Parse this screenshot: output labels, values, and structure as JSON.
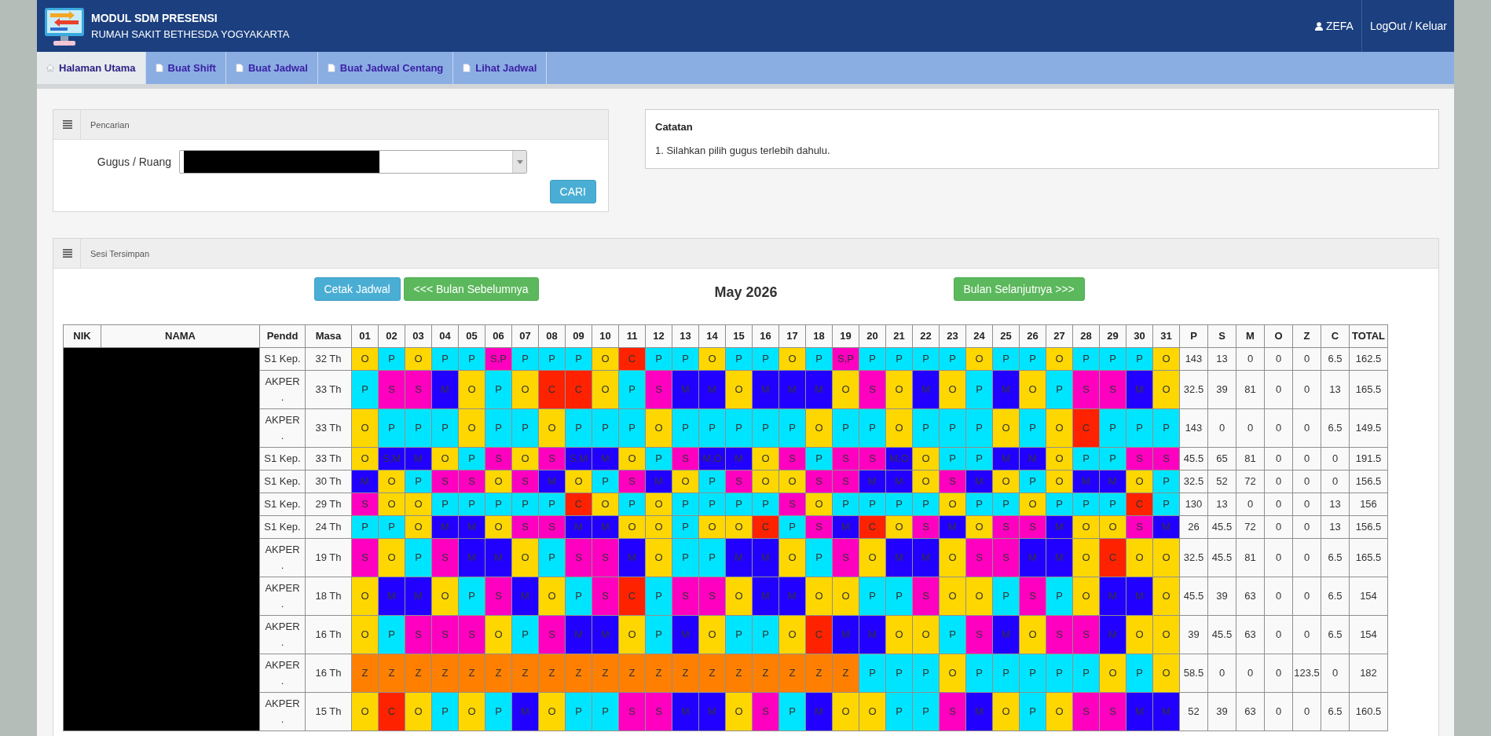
{
  "header": {
    "title": "MODUL SDM PRESENSI",
    "subtitle": "RUMAH SAKIT BETHESDA YOGYAKARTA",
    "user": "ZEFA",
    "logout": "LogOut / Keluar"
  },
  "nav": [
    {
      "label": "Halaman Utama",
      "kind": "home",
      "selected": true
    },
    {
      "label": "Buat Shift",
      "kind": "page",
      "selected": false
    },
    {
      "label": "Buat Jadwal",
      "kind": "page",
      "selected": false
    },
    {
      "label": "Buat Jadwal Centang",
      "kind": "page",
      "selected": false
    },
    {
      "label": "Lihat Jadwal",
      "kind": "page",
      "selected": false
    }
  ],
  "search_panel": {
    "title": "Pencarian",
    "field_label": "Gugus / Ruang",
    "value_hidden": true,
    "button": "CARI"
  },
  "notes_panel": {
    "title": "Catatan",
    "items": [
      "1. Silahkan pilih gugus terlebih dahulu."
    ]
  },
  "schedule_panel": {
    "title": "Sesi Tersimpan",
    "buttons": [
      {
        "label": "Cetak Jadwal",
        "kind": "info"
      },
      {
        "label": "<<< Bulan Sebelumnya",
        "kind": "success"
      }
    ],
    "month": "May 2026",
    "next_button": {
      "label": "Bulan Selanjutnya >>>",
      "kind": "success"
    },
    "table": {
      "columns": [
        "NIK",
        "NAMA",
        "Pendd",
        "Masa"
      ],
      "days": [
        "01",
        "02",
        "03",
        "04",
        "05",
        "06",
        "07",
        "08",
        "09",
        "10",
        "11",
        "12",
        "13",
        "14",
        "15",
        "16",
        "17",
        "18",
        "19",
        "20",
        "21",
        "22",
        "23",
        "24",
        "25",
        "26",
        "27",
        "28",
        "29",
        "30",
        "31"
      ],
      "total_columns": [
        "P",
        "S",
        "M",
        "O",
        "Z",
        "C",
        "TOTAL"
      ],
      "names_hidden": true,
      "rows": [
        {
          "pendd": "S1 Kep.",
          "masa": "32 Th",
          "days": [
            {
              "code": "O",
              "color": "#ffd700"
            },
            {
              "code": "P",
              "color": "#00e5ff"
            },
            {
              "code": "O",
              "color": "#ffd700"
            },
            {
              "code": "P",
              "color": "#00e5ff"
            },
            {
              "code": "P",
              "color": "#00e5ff"
            },
            {
              "code": "S,P",
              "color": "#ff00c0"
            },
            {
              "code": "P",
              "color": "#00e5ff"
            },
            {
              "code": "P",
              "color": "#00e5ff"
            },
            {
              "code": "P",
              "color": "#00e5ff"
            },
            {
              "code": "O",
              "color": "#ffd700"
            },
            {
              "code": "C",
              "color": "#ff2200"
            },
            {
              "code": "P",
              "color": "#00e5ff"
            },
            {
              "code": "P",
              "color": "#00e5ff"
            },
            {
              "code": "O",
              "color": "#ffd700"
            },
            {
              "code": "P",
              "color": "#00e5ff"
            },
            {
              "code": "P",
              "color": "#00e5ff"
            },
            {
              "code": "O",
              "color": "#ffd700"
            },
            {
              "code": "P",
              "color": "#00e5ff"
            },
            {
              "code": "S,P",
              "color": "#ff00c0"
            },
            {
              "code": "P",
              "color": "#00e5ff"
            },
            {
              "code": "P",
              "color": "#00e5ff"
            },
            {
              "code": "P",
              "color": "#00e5ff"
            },
            {
              "code": "P",
              "color": "#00e5ff"
            },
            {
              "code": "O",
              "color": "#ffd700"
            },
            {
              "code": "P",
              "color": "#00e5ff"
            },
            {
              "code": "P",
              "color": "#00e5ff"
            },
            {
              "code": "O",
              "color": "#ffd700"
            },
            {
              "code": "P",
              "color": "#00e5ff"
            },
            {
              "code": "P",
              "color": "#00e5ff"
            },
            {
              "code": "P",
              "color": "#00e5ff"
            },
            {
              "code": "O",
              "color": "#ffd700"
            }
          ],
          "totals": [
            "143",
            "13",
            "0",
            "0",
            "0",
            "6.5",
            "162.5"
          ]
        },
        {
          "pendd": "AKPER .",
          "masa": "33 Th",
          "days": [
            {
              "code": "P",
              "color": "#00e5ff"
            },
            {
              "code": "S",
              "color": "#ff00c0"
            },
            {
              "code": "S",
              "color": "#ff00c0"
            },
            {
              "code": "M",
              "color": "#2200ff"
            },
            {
              "code": "O",
              "color": "#ffd700"
            },
            {
              "code": "P",
              "color": "#00e5ff"
            },
            {
              "code": "O",
              "color": "#ffd700"
            },
            {
              "code": "C",
              "color": "#ff2200"
            },
            {
              "code": "C",
              "color": "#ff2200"
            },
            {
              "code": "O",
              "color": "#ffd700"
            },
            {
              "code": "P",
              "color": "#00e5ff"
            },
            {
              "code": "S",
              "color": "#ff00c0"
            },
            {
              "code": "M",
              "color": "#2200ff"
            },
            {
              "code": "M",
              "color": "#2200ff"
            },
            {
              "code": "O",
              "color": "#ffd700"
            },
            {
              "code": "M",
              "color": "#2200ff"
            },
            {
              "code": "M",
              "color": "#2200ff"
            },
            {
              "code": "M",
              "color": "#2200ff"
            },
            {
              "code": "O",
              "color": "#ffd700"
            },
            {
              "code": "S",
              "color": "#ff00c0"
            },
            {
              "code": "O",
              "color": "#ffd700"
            },
            {
              "code": "M",
              "color": "#2200ff"
            },
            {
              "code": "O",
              "color": "#ffd700"
            },
            {
              "code": "P",
              "color": "#00e5ff"
            },
            {
              "code": "M",
              "color": "#2200ff"
            },
            {
              "code": "O",
              "color": "#ffd700"
            },
            {
              "code": "P",
              "color": "#00e5ff"
            },
            {
              "code": "S",
              "color": "#ff00c0"
            },
            {
              "code": "S",
              "color": "#ff00c0"
            },
            {
              "code": "M",
              "color": "#2200ff"
            },
            {
              "code": "O",
              "color": "#ffd700"
            }
          ],
          "totals": [
            "32.5",
            "39",
            "81",
            "0",
            "0",
            "13",
            "165.5"
          ]
        },
        {
          "pendd": "AKPER .",
          "masa": "33 Th",
          "days": [
            {
              "code": "O",
              "color": "#ffd700"
            },
            {
              "code": "P",
              "color": "#00e5ff"
            },
            {
              "code": "P",
              "color": "#00e5ff"
            },
            {
              "code": "P",
              "color": "#00e5ff"
            },
            {
              "code": "O",
              "color": "#ffd700"
            },
            {
              "code": "P",
              "color": "#00e5ff"
            },
            {
              "code": "P",
              "color": "#00e5ff"
            },
            {
              "code": "O",
              "color": "#ffd700"
            },
            {
              "code": "P",
              "color": "#00e5ff"
            },
            {
              "code": "P",
              "color": "#00e5ff"
            },
            {
              "code": "P",
              "color": "#00e5ff"
            },
            {
              "code": "O",
              "color": "#ffd700"
            },
            {
              "code": "P",
              "color": "#00e5ff"
            },
            {
              "code": "P",
              "color": "#00e5ff"
            },
            {
              "code": "P",
              "color": "#00e5ff"
            },
            {
              "code": "P",
              "color": "#00e5ff"
            },
            {
              "code": "P",
              "color": "#00e5ff"
            },
            {
              "code": "O",
              "color": "#ffd700"
            },
            {
              "code": "P",
              "color": "#00e5ff"
            },
            {
              "code": "P",
              "color": "#00e5ff"
            },
            {
              "code": "O",
              "color": "#ffd700"
            },
            {
              "code": "P",
              "color": "#00e5ff"
            },
            {
              "code": "P",
              "color": "#00e5ff"
            },
            {
              "code": "P",
              "color": "#00e5ff"
            },
            {
              "code": "O",
              "color": "#ffd700"
            },
            {
              "code": "P",
              "color": "#00e5ff"
            },
            {
              "code": "O",
              "color": "#ffd700"
            },
            {
              "code": "C",
              "color": "#ff2200"
            },
            {
              "code": "P",
              "color": "#00e5ff"
            },
            {
              "code": "P",
              "color": "#00e5ff"
            },
            {
              "code": "P",
              "color": "#00e5ff"
            }
          ],
          "totals": [
            "143",
            "0",
            "0",
            "0",
            "0",
            "6.5",
            "149.5"
          ]
        },
        {
          "pendd": "S1 Kep.",
          "masa": "33 Th",
          "days": [
            {
              "code": "O",
              "color": "#ffd700"
            },
            {
              "code": "S,M",
              "color": "#2200ff"
            },
            {
              "code": "M",
              "color": "#2200ff"
            },
            {
              "code": "O",
              "color": "#ffd700"
            },
            {
              "code": "P",
              "color": "#00e5ff"
            },
            {
              "code": "S",
              "color": "#ff00c0"
            },
            {
              "code": "O",
              "color": "#ffd700"
            },
            {
              "code": "S",
              "color": "#ff00c0"
            },
            {
              "code": "S,M",
              "color": "#2200ff"
            },
            {
              "code": "M",
              "color": "#2200ff"
            },
            {
              "code": "O",
              "color": "#ffd700"
            },
            {
              "code": "P",
              "color": "#00e5ff"
            },
            {
              "code": "S",
              "color": "#ff00c0"
            },
            {
              "code": "M,O",
              "color": "#2200ff"
            },
            {
              "code": "M",
              "color": "#2200ff"
            },
            {
              "code": "O",
              "color": "#ffd700"
            },
            {
              "code": "S",
              "color": "#ff00c0"
            },
            {
              "code": "P",
              "color": "#00e5ff"
            },
            {
              "code": "S",
              "color": "#ff00c0"
            },
            {
              "code": "S",
              "color": "#ff00c0"
            },
            {
              "code": "M,O",
              "color": "#2200ff"
            },
            {
              "code": "O",
              "color": "#ffd700"
            },
            {
              "code": "P",
              "color": "#00e5ff"
            },
            {
              "code": "P",
              "color": "#00e5ff"
            },
            {
              "code": "M",
              "color": "#2200ff"
            },
            {
              "code": "M",
              "color": "#2200ff"
            },
            {
              "code": "O",
              "color": "#ffd700"
            },
            {
              "code": "P",
              "color": "#00e5ff"
            },
            {
              "code": "P",
              "color": "#00e5ff"
            },
            {
              "code": "S",
              "color": "#ff00c0"
            },
            {
              "code": "S",
              "color": "#ff00c0"
            }
          ],
          "totals": [
            "45.5",
            "65",
            "81",
            "0",
            "0",
            "0",
            "191.5"
          ]
        },
        {
          "pendd": "S1 Kep.",
          "masa": "30 Th",
          "days": [
            {
              "code": "M",
              "color": "#2200ff"
            },
            {
              "code": "O",
              "color": "#ffd700"
            },
            {
              "code": "P",
              "color": "#00e5ff"
            },
            {
              "code": "S",
              "color": "#ff00c0"
            },
            {
              "code": "S",
              "color": "#ff00c0"
            },
            {
              "code": "O",
              "color": "#ffd700"
            },
            {
              "code": "S",
              "color": "#ff00c0"
            },
            {
              "code": "M",
              "color": "#2200ff"
            },
            {
              "code": "O",
              "color": "#ffd700"
            },
            {
              "code": "P",
              "color": "#00e5ff"
            },
            {
              "code": "S",
              "color": "#ff00c0"
            },
            {
              "code": "M",
              "color": "#2200ff"
            },
            {
              "code": "O",
              "color": "#ffd700"
            },
            {
              "code": "P",
              "color": "#00e5ff"
            },
            {
              "code": "S",
              "color": "#ff00c0"
            },
            {
              "code": "O",
              "color": "#ffd700"
            },
            {
              "code": "O",
              "color": "#ffd700"
            },
            {
              "code": "S",
              "color": "#ff00c0"
            },
            {
              "code": "S",
              "color": "#ff00c0"
            },
            {
              "code": "M",
              "color": "#2200ff"
            },
            {
              "code": "M",
              "color": "#2200ff"
            },
            {
              "code": "O",
              "color": "#ffd700"
            },
            {
              "code": "S",
              "color": "#ff00c0"
            },
            {
              "code": "M",
              "color": "#2200ff"
            },
            {
              "code": "O",
              "color": "#ffd700"
            },
            {
              "code": "P",
              "color": "#00e5ff"
            },
            {
              "code": "O",
              "color": "#ffd700"
            },
            {
              "code": "M",
              "color": "#2200ff"
            },
            {
              "code": "M",
              "color": "#2200ff"
            },
            {
              "code": "O",
              "color": "#ffd700"
            },
            {
              "code": "P",
              "color": "#00e5ff"
            }
          ],
          "totals": [
            "32.5",
            "52",
            "72",
            "0",
            "0",
            "0",
            "156.5"
          ]
        },
        {
          "pendd": "S1 Kep.",
          "masa": "29 Th",
          "days": [
            {
              "code": "S",
              "color": "#ff00c0"
            },
            {
              "code": "O",
              "color": "#ffd700"
            },
            {
              "code": "O",
              "color": "#ffd700"
            },
            {
              "code": "P",
              "color": "#00e5ff"
            },
            {
              "code": "P",
              "color": "#00e5ff"
            },
            {
              "code": "P",
              "color": "#00e5ff"
            },
            {
              "code": "P",
              "color": "#00e5ff"
            },
            {
              "code": "P",
              "color": "#00e5ff"
            },
            {
              "code": "C",
              "color": "#ff2200"
            },
            {
              "code": "O",
              "color": "#ffd700"
            },
            {
              "code": "P",
              "color": "#00e5ff"
            },
            {
              "code": "O",
              "color": "#ffd700"
            },
            {
              "code": "P",
              "color": "#00e5ff"
            },
            {
              "code": "P",
              "color": "#00e5ff"
            },
            {
              "code": "P",
              "color": "#00e5ff"
            },
            {
              "code": "P",
              "color": "#00e5ff"
            },
            {
              "code": "S",
              "color": "#ff00c0"
            },
            {
              "code": "O",
              "color": "#ffd700"
            },
            {
              "code": "P",
              "color": "#00e5ff"
            },
            {
              "code": "P",
              "color": "#00e5ff"
            },
            {
              "code": "P",
              "color": "#00e5ff"
            },
            {
              "code": "P",
              "color": "#00e5ff"
            },
            {
              "code": "O",
              "color": "#ffd700"
            },
            {
              "code": "P",
              "color": "#00e5ff"
            },
            {
              "code": "P",
              "color": "#00e5ff"
            },
            {
              "code": "O",
              "color": "#ffd700"
            },
            {
              "code": "P",
              "color": "#00e5ff"
            },
            {
              "code": "P",
              "color": "#00e5ff"
            },
            {
              "code": "P",
              "color": "#00e5ff"
            },
            {
              "code": "C",
              "color": "#ff2200"
            },
            {
              "code": "P",
              "color": "#00e5ff"
            }
          ],
          "totals": [
            "130",
            "13",
            "0",
            "0",
            "0",
            "13",
            "156"
          ]
        },
        {
          "pendd": "S1 Kep.",
          "masa": "24 Th",
          "days": [
            {
              "code": "P",
              "color": "#00e5ff"
            },
            {
              "code": "P",
              "color": "#00e5ff"
            },
            {
              "code": "O",
              "color": "#ffd700"
            },
            {
              "code": "M",
              "color": "#2200ff"
            },
            {
              "code": "M",
              "color": "#2200ff"
            },
            {
              "code": "O",
              "color": "#ffd700"
            },
            {
              "code": "S",
              "color": "#ff00c0"
            },
            {
              "code": "S",
              "color": "#ff00c0"
            },
            {
              "code": "M",
              "color": "#2200ff"
            },
            {
              "code": "M",
              "color": "#2200ff"
            },
            {
              "code": "O",
              "color": "#ffd700"
            },
            {
              "code": "O",
              "color": "#ffd700"
            },
            {
              "code": "P",
              "color": "#00e5ff"
            },
            {
              "code": "O",
              "color": "#ffd700"
            },
            {
              "code": "O",
              "color": "#ffd700"
            },
            {
              "code": "C",
              "color": "#ff2200"
            },
            {
              "code": "P",
              "color": "#00e5ff"
            },
            {
              "code": "S",
              "color": "#ff00c0"
            },
            {
              "code": "M",
              "color": "#2200ff"
            },
            {
              "code": "C",
              "color": "#ff2200"
            },
            {
              "code": "O",
              "color": "#ffd700"
            },
            {
              "code": "S",
              "color": "#ff00c0"
            },
            {
              "code": "M",
              "color": "#2200ff"
            },
            {
              "code": "O",
              "color": "#ffd700"
            },
            {
              "code": "S",
              "color": "#ff00c0"
            },
            {
              "code": "S",
              "color": "#ff00c0"
            },
            {
              "code": "M",
              "color": "#2200ff"
            },
            {
              "code": "O",
              "color": "#ffd700"
            },
            {
              "code": "O",
              "color": "#ffd700"
            },
            {
              "code": "S",
              "color": "#ff00c0"
            },
            {
              "code": "M",
              "color": "#2200ff"
            }
          ],
          "totals": [
            "26",
            "45.5",
            "72",
            "0",
            "0",
            "13",
            "156.5"
          ]
        },
        {
          "pendd": "AKPER .",
          "masa": "19 Th",
          "days": [
            {
              "code": "S",
              "color": "#ff00c0"
            },
            {
              "code": "O",
              "color": "#ffd700"
            },
            {
              "code": "P",
              "color": "#00e5ff"
            },
            {
              "code": "S",
              "color": "#ff00c0"
            },
            {
              "code": "M",
              "color": "#2200ff"
            },
            {
              "code": "M",
              "color": "#2200ff"
            },
            {
              "code": "O",
              "color": "#ffd700"
            },
            {
              "code": "P",
              "color": "#00e5ff"
            },
            {
              "code": "S",
              "color": "#ff00c0"
            },
            {
              "code": "S",
              "color": "#ff00c0"
            },
            {
              "code": "M",
              "color": "#2200ff"
            },
            {
              "code": "O",
              "color": "#ffd700"
            },
            {
              "code": "P",
              "color": "#00e5ff"
            },
            {
              "code": "P",
              "color": "#00e5ff"
            },
            {
              "code": "M",
              "color": "#2200ff"
            },
            {
              "code": "M",
              "color": "#2200ff"
            },
            {
              "code": "O",
              "color": "#ffd700"
            },
            {
              "code": "P",
              "color": "#00e5ff"
            },
            {
              "code": "S",
              "color": "#ff00c0"
            },
            {
              "code": "O",
              "color": "#ffd700"
            },
            {
              "code": "M",
              "color": "#2200ff"
            },
            {
              "code": "M",
              "color": "#2200ff"
            },
            {
              "code": "O",
              "color": "#ffd700"
            },
            {
              "code": "S",
              "color": "#ff00c0"
            },
            {
              "code": "S",
              "color": "#ff00c0"
            },
            {
              "code": "M",
              "color": "#2200ff"
            },
            {
              "code": "M",
              "color": "#2200ff"
            },
            {
              "code": "O",
              "color": "#ffd700"
            },
            {
              "code": "C",
              "color": "#ff2200"
            },
            {
              "code": "O",
              "color": "#ffd700"
            },
            {
              "code": "O",
              "color": "#ffd700"
            }
          ],
          "totals": [
            "32.5",
            "45.5",
            "81",
            "0",
            "0",
            "6.5",
            "165.5"
          ]
        },
        {
          "pendd": "AKPER .",
          "masa": "18 Th",
          "days": [
            {
              "code": "O",
              "color": "#ffd700"
            },
            {
              "code": "M",
              "color": "#2200ff"
            },
            {
              "code": "M",
              "color": "#2200ff"
            },
            {
              "code": "O",
              "color": "#ffd700"
            },
            {
              "code": "P",
              "color": "#00e5ff"
            },
            {
              "code": "S",
              "color": "#ff00c0"
            },
            {
              "code": "M",
              "color": "#2200ff"
            },
            {
              "code": "O",
              "color": "#ffd700"
            },
            {
              "code": "P",
              "color": "#00e5ff"
            },
            {
              "code": "S",
              "color": "#ff00c0"
            },
            {
              "code": "C",
              "color": "#ff2200"
            },
            {
              "code": "P",
              "color": "#00e5ff"
            },
            {
              "code": "S",
              "color": "#ff00c0"
            },
            {
              "code": "S",
              "color": "#ff00c0"
            },
            {
              "code": "O",
              "color": "#ffd700"
            },
            {
              "code": "M",
              "color": "#2200ff"
            },
            {
              "code": "M",
              "color": "#2200ff"
            },
            {
              "code": "O",
              "color": "#ffd700"
            },
            {
              "code": "O",
              "color": "#ffd700"
            },
            {
              "code": "P",
              "color": "#00e5ff"
            },
            {
              "code": "P",
              "color": "#00e5ff"
            },
            {
              "code": "S",
              "color": "#ff00c0"
            },
            {
              "code": "O",
              "color": "#ffd700"
            },
            {
              "code": "O",
              "color": "#ffd700"
            },
            {
              "code": "P",
              "color": "#00e5ff"
            },
            {
              "code": "S",
              "color": "#ff00c0"
            },
            {
              "code": "P",
              "color": "#00e5ff"
            },
            {
              "code": "O",
              "color": "#ffd700"
            },
            {
              "code": "M",
              "color": "#2200ff"
            },
            {
              "code": "M",
              "color": "#2200ff"
            },
            {
              "code": "O",
              "color": "#ffd700"
            }
          ],
          "totals": [
            "45.5",
            "39",
            "63",
            "0",
            "0",
            "6.5",
            "154"
          ]
        },
        {
          "pendd": "AKPER .",
          "masa": "16 Th",
          "days": [
            {
              "code": "O",
              "color": "#ffd700"
            },
            {
              "code": "P",
              "color": "#00e5ff"
            },
            {
              "code": "S",
              "color": "#ff00c0"
            },
            {
              "code": "S",
              "color": "#ff00c0"
            },
            {
              "code": "S",
              "color": "#ff00c0"
            },
            {
              "code": "O",
              "color": "#ffd700"
            },
            {
              "code": "P",
              "color": "#00e5ff"
            },
            {
              "code": "S",
              "color": "#ff00c0"
            },
            {
              "code": "M",
              "color": "#2200ff"
            },
            {
              "code": "M",
              "color": "#2200ff"
            },
            {
              "code": "O",
              "color": "#ffd700"
            },
            {
              "code": "P",
              "color": "#00e5ff"
            },
            {
              "code": "M",
              "color": "#2200ff"
            },
            {
              "code": "O",
              "color": "#ffd700"
            },
            {
              "code": "P",
              "color": "#00e5ff"
            },
            {
              "code": "P",
              "color": "#00e5ff"
            },
            {
              "code": "O",
              "color": "#ffd700"
            },
            {
              "code": "C",
              "color": "#ff2200"
            },
            {
              "code": "M",
              "color": "#2200ff"
            },
            {
              "code": "M",
              "color": "#2200ff"
            },
            {
              "code": "O",
              "color": "#ffd700"
            },
            {
              "code": "O",
              "color": "#ffd700"
            },
            {
              "code": "P",
              "color": "#00e5ff"
            },
            {
              "code": "S",
              "color": "#ff00c0"
            },
            {
              "code": "M",
              "color": "#2200ff"
            },
            {
              "code": "O",
              "color": "#ffd700"
            },
            {
              "code": "S",
              "color": "#ff00c0"
            },
            {
              "code": "S",
              "color": "#ff00c0"
            },
            {
              "code": "M",
              "color": "#2200ff"
            },
            {
              "code": "O",
              "color": "#ffd700"
            },
            {
              "code": "O",
              "color": "#ffd700"
            }
          ],
          "totals": [
            "39",
            "45.5",
            "63",
            "0",
            "0",
            "6.5",
            "154"
          ]
        },
        {
          "pendd": "AKPER .",
          "masa": "16 Th",
          "days": [
            {
              "code": "Z",
              "color": "#ff8000"
            },
            {
              "code": "Z",
              "color": "#ff8000"
            },
            {
              "code": "Z",
              "color": "#ff8000"
            },
            {
              "code": "Z",
              "color": "#ff8000"
            },
            {
              "code": "Z",
              "color": "#ff8000"
            },
            {
              "code": "Z",
              "color": "#ff8000"
            },
            {
              "code": "Z",
              "color": "#ff8000"
            },
            {
              "code": "Z",
              "color": "#ff8000"
            },
            {
              "code": "Z",
              "color": "#ff8000"
            },
            {
              "code": "Z",
              "color": "#ff8000"
            },
            {
              "code": "Z",
              "color": "#ff8000"
            },
            {
              "code": "Z",
              "color": "#ff8000"
            },
            {
              "code": "Z",
              "color": "#ff8000"
            },
            {
              "code": "Z",
              "color": "#ff8000"
            },
            {
              "code": "Z",
              "color": "#ff8000"
            },
            {
              "code": "Z",
              "color": "#ff8000"
            },
            {
              "code": "Z",
              "color": "#ff8000"
            },
            {
              "code": "Z",
              "color": "#ff8000"
            },
            {
              "code": "Z",
              "color": "#ff8000"
            },
            {
              "code": "P",
              "color": "#00e5ff"
            },
            {
              "code": "P",
              "color": "#00e5ff"
            },
            {
              "code": "P",
              "color": "#00e5ff"
            },
            {
              "code": "O",
              "color": "#ffd700"
            },
            {
              "code": "P",
              "color": "#00e5ff"
            },
            {
              "code": "P",
              "color": "#00e5ff"
            },
            {
              "code": "P",
              "color": "#00e5ff"
            },
            {
              "code": "P",
              "color": "#00e5ff"
            },
            {
              "code": "P",
              "color": "#00e5ff"
            },
            {
              "code": "O",
              "color": "#ffd700"
            },
            {
              "code": "P",
              "color": "#00e5ff"
            },
            {
              "code": "O",
              "color": "#ffd700"
            }
          ],
          "totals": [
            "58.5",
            "0",
            "0",
            "0",
            "123.5",
            "0",
            "182"
          ]
        },
        {
          "pendd": "AKPER .",
          "masa": "15 Th",
          "days": [
            {
              "code": "O",
              "color": "#ffd700"
            },
            {
              "code": "C",
              "color": "#ff2200"
            },
            {
              "code": "O",
              "color": "#ffd700"
            },
            {
              "code": "P",
              "color": "#00e5ff"
            },
            {
              "code": "O",
              "color": "#ffd700"
            },
            {
              "code": "P",
              "color": "#00e5ff"
            },
            {
              "code": "M",
              "color": "#2200ff"
            },
            {
              "code": "O",
              "color": "#ffd700"
            },
            {
              "code": "P",
              "color": "#00e5ff"
            },
            {
              "code": "P",
              "color": "#00e5ff"
            },
            {
              "code": "S",
              "color": "#ff00c0"
            },
            {
              "code": "S",
              "color": "#ff00c0"
            },
            {
              "code": "M",
              "color": "#2200ff"
            },
            {
              "code": "M",
              "color": "#2200ff"
            },
            {
              "code": "O",
              "color": "#ffd700"
            },
            {
              "code": "S",
              "color": "#ff00c0"
            },
            {
              "code": "P",
              "color": "#00e5ff"
            },
            {
              "code": "M",
              "color": "#2200ff"
            },
            {
              "code": "O",
              "color": "#ffd700"
            },
            {
              "code": "O",
              "color": "#ffd700"
            },
            {
              "code": "P",
              "color": "#00e5ff"
            },
            {
              "code": "P",
              "color": "#00e5ff"
            },
            {
              "code": "S",
              "color": "#ff00c0"
            },
            {
              "code": "M",
              "color": "#2200ff"
            },
            {
              "code": "O",
              "color": "#ffd700"
            },
            {
              "code": "P",
              "color": "#00e5ff"
            },
            {
              "code": "O",
              "color": "#ffd700"
            },
            {
              "code": "S",
              "color": "#ff00c0"
            },
            {
              "code": "S",
              "color": "#ff00c0"
            },
            {
              "code": "M",
              "color": "#2200ff"
            },
            {
              "code": "M",
              "color": "#2200ff"
            }
          ],
          "totals": [
            "52",
            "39",
            "63",
            "0",
            "0",
            "6.5",
            "160.5"
          ]
        }
      ]
    }
  }
}
